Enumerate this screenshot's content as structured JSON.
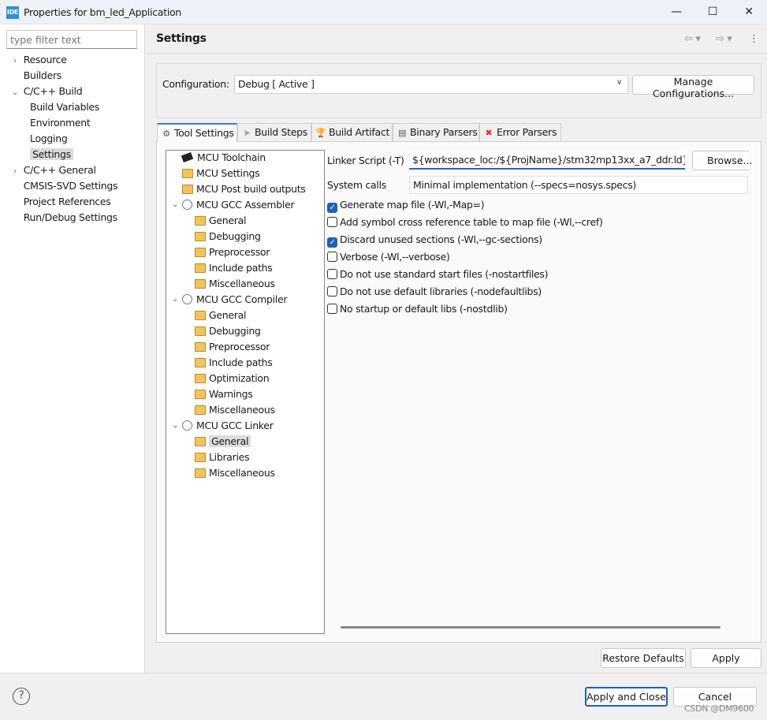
{
  "window": {
    "title": "Properties for bm_led_Application",
    "app_icon": "IDE"
  },
  "filter": {
    "placeholder": "type filter text"
  },
  "nav": [
    {
      "label": "Resource",
      "level": 0,
      "twisty": ">"
    },
    {
      "label": "Builders",
      "level": 0,
      "twisty": ""
    },
    {
      "label": "C/C++ Build",
      "level": 0,
      "twisty": "v"
    },
    {
      "label": "Build Variables",
      "level": 1,
      "twisty": ""
    },
    {
      "label": "Environment",
      "level": 1,
      "twisty": ""
    },
    {
      "label": "Logging",
      "level": 1,
      "twisty": ""
    },
    {
      "label": "Settings",
      "level": 1,
      "twisty": "",
      "selected": true
    },
    {
      "label": "C/C++ General",
      "level": 0,
      "twisty": ">"
    },
    {
      "label": "CMSIS-SVD Settings",
      "level": 0,
      "twisty": ""
    },
    {
      "label": "Project References",
      "level": 0,
      "twisty": ""
    },
    {
      "label": "Run/Debug Settings",
      "level": 0,
      "twisty": ""
    }
  ],
  "header": {
    "title": "Settings"
  },
  "config": {
    "label": "Configuration:",
    "value": "Debug  [ Active ]",
    "manage": "Manage Configurations..."
  },
  "tabs": [
    "Tool Settings",
    "Build Steps",
    "Build Artifact",
    "Binary Parsers",
    "Error Parsers"
  ],
  "tree": [
    {
      "label": "MCU Toolchain",
      "level": 0,
      "icon": "chip",
      "twisty": ""
    },
    {
      "label": "MCU Settings",
      "level": 0,
      "icon": "folder",
      "twisty": ""
    },
    {
      "label": "MCU Post build outputs",
      "level": 0,
      "icon": "folder",
      "twisty": ""
    },
    {
      "label": "MCU GCC Assembler",
      "level": 0,
      "icon": "gear",
      "twisty": "v"
    },
    {
      "label": "General",
      "level": 1,
      "icon": "folder"
    },
    {
      "label": "Debugging",
      "level": 1,
      "icon": "folder"
    },
    {
      "label": "Preprocessor",
      "level": 1,
      "icon": "folder"
    },
    {
      "label": "Include paths",
      "level": 1,
      "icon": "folder"
    },
    {
      "label": "Miscellaneous",
      "level": 1,
      "icon": "folder"
    },
    {
      "label": "MCU GCC Compiler",
      "level": 0,
      "icon": "gear",
      "twisty": "v"
    },
    {
      "label": "General",
      "level": 1,
      "icon": "folder"
    },
    {
      "label": "Debugging",
      "level": 1,
      "icon": "folder"
    },
    {
      "label": "Preprocessor",
      "level": 1,
      "icon": "folder"
    },
    {
      "label": "Include paths",
      "level": 1,
      "icon": "folder"
    },
    {
      "label": "Optimization",
      "level": 1,
      "icon": "folder"
    },
    {
      "label": "Warnings",
      "level": 1,
      "icon": "folder"
    },
    {
      "label": "Miscellaneous",
      "level": 1,
      "icon": "folder"
    },
    {
      "label": "MCU GCC Linker",
      "level": 0,
      "icon": "gear",
      "twisty": "v"
    },
    {
      "label": "General",
      "level": 1,
      "icon": "folder",
      "selected": true
    },
    {
      "label": "Libraries",
      "level": 1,
      "icon": "folder"
    },
    {
      "label": "Miscellaneous",
      "level": 1,
      "icon": "folder"
    }
  ],
  "linker": {
    "label": "Linker Script (-T)",
    "value": "${workspace_loc:/${ProjName}/stm32mp13xx_a7_ddr.ld}",
    "browse": "Browse..."
  },
  "syscalls": {
    "label": "System calls",
    "value": "Minimal implementation (--specs=nosys.specs)"
  },
  "options": [
    {
      "label": "Generate map file (-Wl,-Map=)",
      "checked": true
    },
    {
      "label": "Add symbol cross reference table to map file (-Wl,--cref)",
      "checked": false
    },
    {
      "label": "Discard unused sections (-Wl,--gc-sections)",
      "checked": true
    },
    {
      "label": "Verbose (-Wl,--verbose)",
      "checked": false
    },
    {
      "label": "Do not use standard start files (-nostartfiles)",
      "checked": false
    },
    {
      "label": "Do not use default libraries (-nodefaultlibs)",
      "checked": false
    },
    {
      "label": "No startup or default libs (-nostdlib)",
      "checked": false
    }
  ],
  "buttons": {
    "restore": "Restore Defaults",
    "apply": "Apply",
    "apply_close": "Apply and Close",
    "cancel": "Cancel"
  },
  "watermark": "CSDN @DM9600",
  "colors": {
    "accent": "#1f5fbf",
    "selection": "#dcdcdc"
  }
}
